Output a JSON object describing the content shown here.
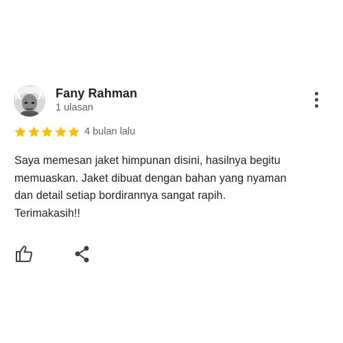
{
  "reviewer": {
    "name": "Fany Rahman",
    "review_count": "1 ulasan",
    "avatar_icon": "avatar-photo"
  },
  "menu": {
    "icon": "more-vertical-icon"
  },
  "rating": {
    "stars": 5,
    "max_stars": 5,
    "star_color": "#fbbc04",
    "time": "4 bulan lalu"
  },
  "review": {
    "lines": [
      "Saya memesan jaket himpunan disini, hasilnya begitu",
      "memuaskan. Jaket dibuat dengan bahan yang nyaman",
      "dan detail setiap bordirannya sangat rapih.",
      "Terimakasih!!"
    ]
  },
  "actions": {
    "like_icon": "thumbs-up-icon",
    "share_icon": "share-icon"
  }
}
